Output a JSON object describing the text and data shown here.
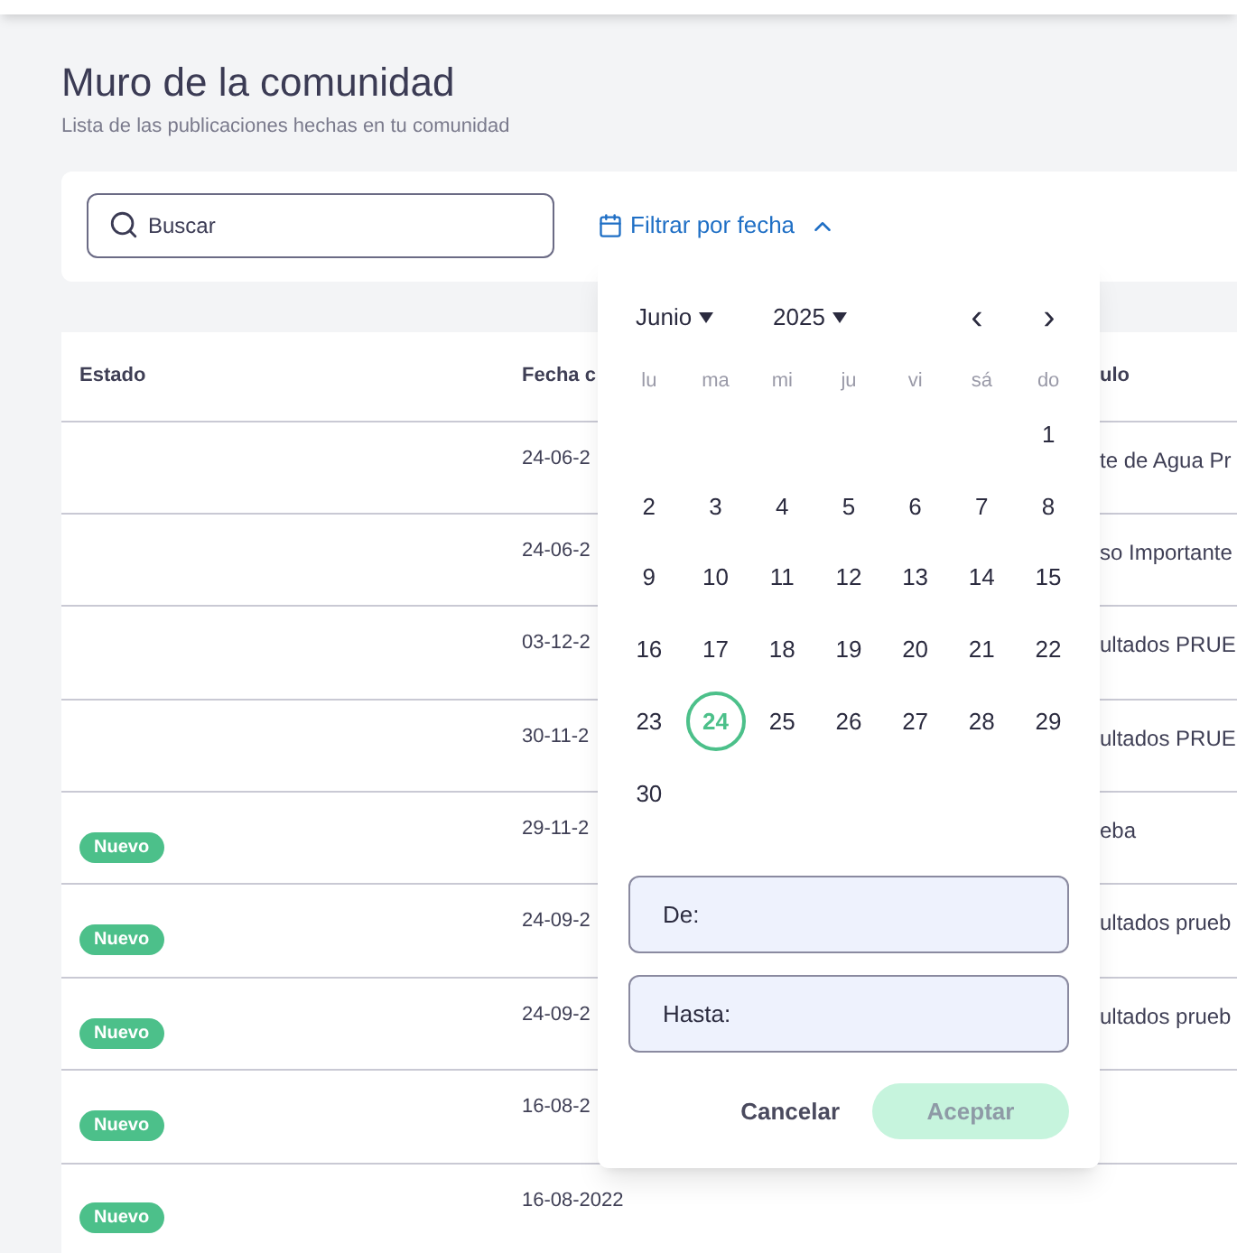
{
  "page": {
    "title": "Muro de la comunidad",
    "subtitle": "Lista de las publicaciones hechas en tu comunidad"
  },
  "search": {
    "placeholder": "Buscar"
  },
  "date_filter": {
    "label": "Filtrar por fecha",
    "expanded": true
  },
  "table": {
    "columns": [
      "Estado",
      "Fecha c",
      "ulo"
    ],
    "rows": [
      {
        "status": null,
        "date": "24-06-2",
        "title": "te de Agua Pr"
      },
      {
        "status": null,
        "date": "24-06-2",
        "title": "so Importante"
      },
      {
        "status": null,
        "date": "03-12-2",
        "title": "ultados PRUE"
      },
      {
        "status": null,
        "date": "30-11-2",
        "title": "ultados PRUE"
      },
      {
        "status": "Nuevo",
        "date": "29-11-2",
        "title": "eba"
      },
      {
        "status": "Nuevo",
        "date": "24-09-2",
        "title": "ultados prueb"
      },
      {
        "status": "Nuevo",
        "date": "24-09-2",
        "title": "ultados prueb"
      },
      {
        "status": "Nuevo",
        "date": "16-08-2",
        "title": null
      },
      {
        "status": "Nuevo",
        "date": "16-08-2022",
        "title": null
      }
    ]
  },
  "calendar": {
    "month": "Junio",
    "year": "2025",
    "prev": "‹",
    "next": "›",
    "weekdays": [
      "lu",
      "ma",
      "mi",
      "ju",
      "vi",
      "sá",
      "do"
    ],
    "weeks": [
      [
        {
          "label": "1",
          "selected": false
        }
      ],
      [
        {
          "label": "2",
          "selected": false
        },
        {
          "label": "3",
          "selected": false
        },
        {
          "label": "4",
          "selected": false
        },
        {
          "label": "5",
          "selected": false
        },
        {
          "label": "6",
          "selected": false
        },
        {
          "label": "7",
          "selected": false
        },
        {
          "label": "8",
          "selected": false
        }
      ],
      [
        {
          "label": "9",
          "selected": false
        },
        {
          "label": "10",
          "selected": false
        },
        {
          "label": "11",
          "selected": false
        },
        {
          "label": "12",
          "selected": false
        },
        {
          "label": "13",
          "selected": false
        },
        {
          "label": "14",
          "selected": false
        },
        {
          "label": "15",
          "selected": false
        }
      ],
      [
        {
          "label": "16",
          "selected": false
        },
        {
          "label": "17",
          "selected": false
        },
        {
          "label": "18",
          "selected": false
        },
        {
          "label": "19",
          "selected": false
        },
        {
          "label": "20",
          "selected": false
        },
        {
          "label": "21",
          "selected": false
        },
        {
          "label": "22",
          "selected": false
        }
      ],
      [
        {
          "label": "23",
          "selected": false
        },
        {
          "label": "24",
          "selected": true
        },
        {
          "label": "25",
          "selected": false
        },
        {
          "label": "26",
          "selected": false
        },
        {
          "label": "27",
          "selected": false
        },
        {
          "label": "28",
          "selected": false
        },
        {
          "label": "29",
          "selected": false
        }
      ],
      [
        {
          "label": "30",
          "selected": false
        }
      ]
    ],
    "from_placeholder": "De:",
    "to_placeholder": "Hasta:",
    "cancel": "Cancelar",
    "accept": "Aceptar",
    "accept_disabled": true
  }
}
